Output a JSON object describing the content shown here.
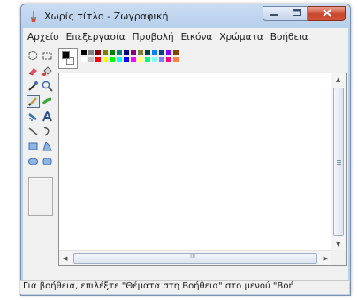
{
  "window": {
    "title": "Χωρίς τίτλο - Ζωγραφική",
    "app_icon": "paint-brush-icon"
  },
  "caption_buttons": {
    "minimize": "minimize-icon",
    "maximize": "maximize-icon",
    "close": "close-icon"
  },
  "menu": {
    "items": [
      "Αρχείο",
      "Επεξεργασία",
      "Προβολή",
      "Εικόνα",
      "Χρώματα",
      "Βοήθεια"
    ]
  },
  "tools": [
    "free-form-select-icon",
    "rectangle-select-icon",
    "eraser-icon",
    "fill-bucket-icon",
    "color-picker-icon",
    "magnifier-icon",
    "pencil-icon",
    "brush-icon",
    "airbrush-icon",
    "text-tool-icon",
    "line-icon",
    "curve-icon",
    "rectangle-icon",
    "polygon-icon",
    "ellipse-icon",
    "rounded-rectangle-icon"
  ],
  "selected_tool": "pencil-icon",
  "colors": {
    "foreground": "#000000",
    "background": "#ffffff",
    "palette_row1": [
      "#000000",
      "#808080",
      "#800000",
      "#808000",
      "#008000",
      "#008080",
      "#000080",
      "#800080",
      "#808040",
      "#004040",
      "#0080ff",
      "#004080",
      "#8000ff",
      "#804000"
    ],
    "palette_row2": [
      "#ffffff",
      "#c0c0c0",
      "#ff0000",
      "#ffff00",
      "#00ff00",
      "#00ffff",
      "#0000ff",
      "#ff00ff",
      "#ffff80",
      "#00ff80",
      "#80ffff",
      "#8080ff",
      "#ff0080",
      "#ff8040"
    ]
  },
  "scrollbar": {
    "horizontal_thumb_label": "III"
  },
  "status": {
    "text": "Για βοήθεια, επιλέξτε \"Θέματα στη Βοήθεια\" στο μενού \"Βοήθεια\""
  }
}
